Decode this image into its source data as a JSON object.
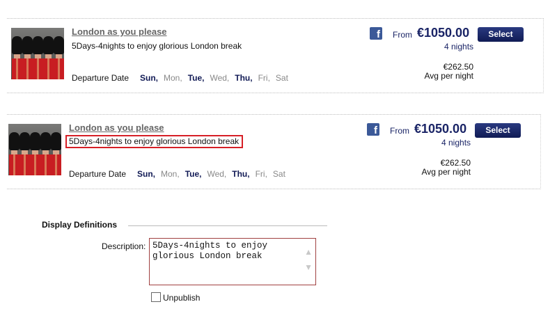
{
  "listings": [
    {
      "title": "London as you please",
      "description": "5Days-4nights to enjoy glorious London break",
      "departure_label": "Departure Date",
      "days": [
        {
          "label": "Sun,",
          "active": true
        },
        {
          "label": "Mon,",
          "active": false
        },
        {
          "label": "Tue,",
          "active": true
        },
        {
          "label": "Wed,",
          "active": false
        },
        {
          "label": "Thu,",
          "active": true
        },
        {
          "label": "Fri,",
          "active": false
        },
        {
          "label": "Sat",
          "active": false
        }
      ],
      "from_label": "From",
      "price": "€1050.00",
      "select_label": "Select",
      "nights": "4 nights",
      "avg_price": "€262.50",
      "avg_label": "Avg per night",
      "highlighted": false
    },
    {
      "title": "London as you please",
      "description": "5Days-4nights to enjoy glorious London break",
      "departure_label": "Departure Date",
      "days": [
        {
          "label": "Sun,",
          "active": true
        },
        {
          "label": "Mon,",
          "active": false
        },
        {
          "label": "Tue,",
          "active": true
        },
        {
          "label": "Wed,",
          "active": false
        },
        {
          "label": "Thu,",
          "active": true
        },
        {
          "label": "Fri,",
          "active": false
        },
        {
          "label": "Sat",
          "active": false
        }
      ],
      "from_label": "From",
      "price": "€1050.00",
      "select_label": "Select",
      "nights": "4 nights",
      "avg_price": "€262.50",
      "avg_label": "Avg per night",
      "highlighted": true
    }
  ],
  "display_definitions": {
    "title": "Display Definitions",
    "description_label": "Description:",
    "description_value": "5Days-4nights to enjoy glorious London break",
    "unpublish_label": "Unpublish",
    "unpublish_checked": false
  },
  "icons": {
    "facebook": "facebook-icon",
    "scroll_up": "chevron-up-icon",
    "scroll_down": "chevron-down-icon"
  },
  "colors": {
    "accent": "#1a2466",
    "highlight_border": "#d61f26",
    "facebook": "#3b5998"
  }
}
